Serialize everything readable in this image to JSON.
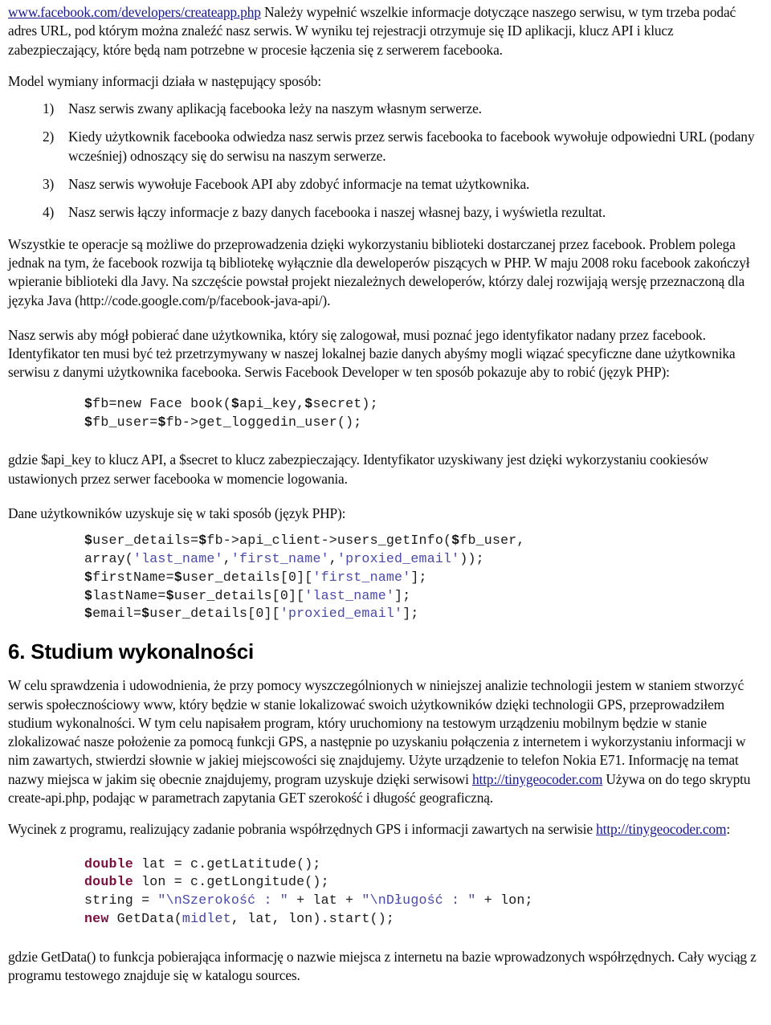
{
  "document": {
    "intro": {
      "link_text": "www.facebook.com/developers/createapp.php",
      "paragraph_after_link": " Należy wypełnić wszelkie informacje dotyczące naszego serwisu, w tym trzeba podać adres URL, pod którym można znaleźć nasz serwis. W wyniku tej rejestracji otrzymuje się ID aplikacji, klucz API i klucz zabezpieczający, które będą nam potrzebne w procesie łączenia się z serwerem facebooka."
    },
    "model_intro": "Model wymiany informacji działa w następujący sposób:",
    "numbered_list": [
      {
        "marker": "1)",
        "text": "Nasz serwis zwany aplikacją facebooka leży na naszym własnym serwerze."
      },
      {
        "marker": "2)",
        "text": "Kiedy użytkownik facebooka odwiedza nasz serwis przez serwis facebooka to facebook wywołuje odpowiedni URL (podany wcześniej) odnoszący się do serwisu na naszym serwerze."
      },
      {
        "marker": "3)",
        "text": "Nasz serwis wywołuje Facebook API aby zdobyć informacje na temat użytkownika."
      },
      {
        "marker": "4)",
        "text": "Nasz serwis łączy informacje z bazy danych facebooka i naszej własnej bazy, i wyświetla rezultat."
      }
    ],
    "paragraph_library": "Wszystkie te operacje są możliwe do przeprowadzenia dzięki wykorzystaniu biblioteki dostarczanej przez facebook. Problem polega jednak na tym, że facebook rozwija tą bibliotekę wyłącznie dla deweloperów piszących w PHP. W maju 2008 roku facebook zakończył wpieranie biblioteki dla Javy. Na szczęście powstał projekt niezależnych deweloperów, którzy dalej rozwijają wersję przeznaczoną dla języka Java (http://code.google.com/p/facebook-java-api/).",
    "paragraph_identifier": "Nasz serwis aby mógł pobierać dane użytkownika, który się zalogował, musi poznać jego identyfikator nadany przez facebook. Identyfikator ten musi być też przetrzymywany w naszej lokalnej bazie danych abyśmy mogli wiązać specyficzne dane użytkownika serwisu z danymi użytkownika facebooka. Serwis Facebook Developer w ten sposób pokazuje aby to robić (język PHP):",
    "code_php_1": {
      "language": "php",
      "lines": [
        "$fb=new Face book($api_key,$secret);",
        "$fb_user=$fb->get_loggedin_user();"
      ]
    },
    "paragraph_keys": "gdzie $api_key to klucz API, a $secret to klucz zabezpieczający. Identyfikator uzyskiwany jest dzięki wykorzystaniu cookiesów ustawionych przez serwer facebooka w momencie logowania.",
    "paragraph_userdata": "Dane użytkowników uzyskuje się w taki sposób (język PHP):",
    "code_php_2": {
      "language": "php",
      "lines": [
        "$user_details=$fb->api_client->users_getInfo($fb_user,",
        "array('last_name','first_name','proxied_email'));",
        "$firstName=$user_details[0]['first_name'];",
        "$lastName=$user_details[0]['last_name'];",
        "$email=$user_details[0]['proxied_email'];"
      ]
    },
    "heading_6": "6. Studium wykonalności",
    "paragraph_feasibility_1_a": "W celu sprawdzenia i udowodnienia, że przy pomocy wyszczególnionych w niniejszej analizie technologii jestem w staniem stworzyć serwis społecznościowy www, który będzie w stanie lokalizować swoich użytkowników dzięki technologii GPS, przeprowadziłem studium wykonalności. W tym celu napisałem program, który uruchomiony na testowym urządzeniu mobilnym będzie w stanie zlokalizować nasze położenie za pomocą funkcji GPS, a następnie po uzyskaniu połączenia z internetem i wykorzystaniu informacji w nim zawartych, stwierdzi słownie w jakiej miejscowości się znajdujemy. Użyte urządzenie to telefon Nokia E71. Informację na temat nazwy miejsca w jakim się obecnie znajdujemy, program uzyskuje dzięki serwisowi ",
    "paragraph_feasibility_link": "http://tinygeocoder.com",
    "paragraph_feasibility_1_b": " Używa on do tego skryptu create-api.php, podając w parametrach zapytania GET szerokość i długość geograficzną.",
    "paragraph_excerpt_a": "Wycinek z programu, realizujący zadanie pobrania współrzędnych GPS i informacji zawartych na serwisie ",
    "paragraph_excerpt_link": "http://tinygeocoder.com",
    "paragraph_excerpt_b": ":",
    "code_java": {
      "language": "java",
      "lines": [
        "double lat = c.getLatitude();",
        "double lon = c.getLongitude();",
        "string = \"\\nSzerokość : \" + lat + \"\\nDługość : \" + lon;",
        "new GetData(midlet, lat, lon).start();"
      ]
    },
    "paragraph_getdata": "gdzie GetData() to funkcja pobierająca informację o nazwie miejsca z internetu na bazie wprowadzonych współrzędnych. Cały wyciąg z programu testowego znajduje się w katalogu sources."
  },
  "colors": {
    "link": "#17178c",
    "code_keyword": "#7a1040",
    "code_string": "#4a4aa8",
    "code_identifier": "#43439b",
    "text": "#0d0d0d",
    "background": "#ffffff"
  }
}
